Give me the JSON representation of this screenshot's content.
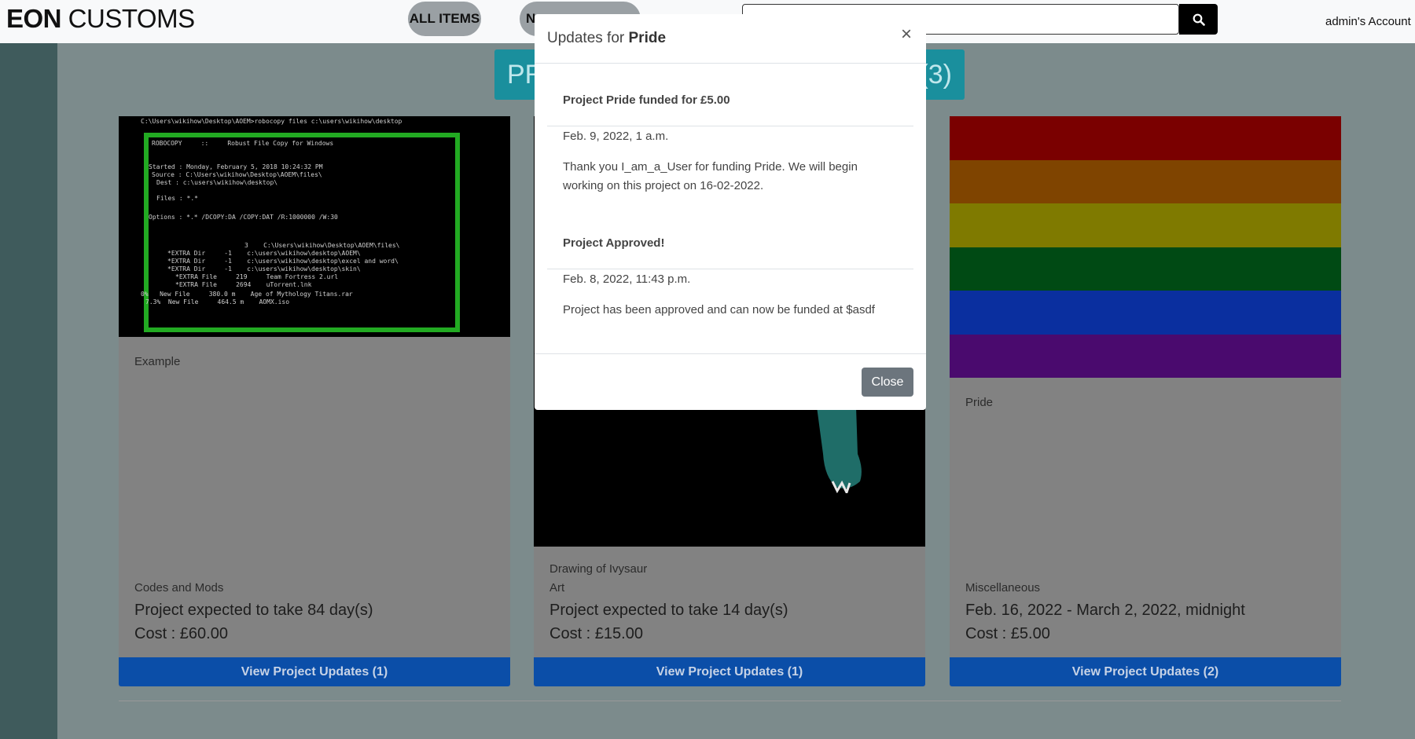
{
  "nav": {
    "brand_bold": "EON",
    "brand_rest": " CUSTOMS",
    "all_items": "ALL ITEMS",
    "new_partial": "N",
    "search": {
      "placeholder": "",
      "value": ""
    },
    "account": "admin's Account"
  },
  "heading": {
    "left": "PR",
    "right": "(3)"
  },
  "cards": [
    {
      "terminal_lines": [
        "C:\\Users\\wikihow\\Desktop\\AOEM>robocopy files c:\\users\\wikihow\\desktop",
        "ROBOCOPY     ::     Robust File Copy for Windows",
        "Started : Monday, February 5, 2018 10:24:32 PM",
        "Source : C:\\Users\\wikihow\\Desktop\\AOEM\\files\\",
        "Dest : c:\\users\\wikihow\\desktop\\",
        "Files : *.*",
        "Options : *.* /DCOPY:DA /COPY:DAT /R:1000000 /W:30",
        "3    C:\\Users\\wikihow\\Desktop\\AOEM\\files\\",
        "*EXTRA Dir     -1    c:\\users\\wikihow\\desktop\\AOEM\\",
        "*EXTRA Dir     -1    c:\\users\\wikihow\\desktop\\excel and word\\",
        "*EXTRA Dir     -1    c:\\users\\wikihow\\desktop\\skin\\",
        "*EXTRA File     219     Team Fortress 2.url",
        "*EXTRA File     2694    uTorrent.lnk",
        "0%   New File     380.0 m    Age of Mythology Titans.rar",
        "7.3%  New File     464.5 m    AOMX.iso"
      ],
      "name": "Example",
      "category": "Codes and Mods",
      "duration": "Project expected to take 84 day(s)",
      "cost": "Cost : £60.00",
      "button": "View Project Updates (1)"
    },
    {
      "name": "Drawing of Ivysaur",
      "category": "Art",
      "duration": "Project expected to take 14 day(s)",
      "cost": "Cost : £15.00",
      "button": "View Project Updates (1)"
    },
    {
      "name": "Pride",
      "category": "Miscellaneous",
      "duration": "Feb. 16, 2022 - March 2, 2022, midnight",
      "cost": "Cost : £5.00",
      "button": "View Project Updates (2)"
    }
  ],
  "modal": {
    "title_prefix": "Updates for ",
    "title_name": "Pride",
    "close_x": "×",
    "updates": [
      {
        "title": "Project Pride funded for £5.00",
        "date": "Feb. 9, 2022, 1 a.m.",
        "text": "Thank you I_am_a_User for funding Pride. We will begin working on this project on 16-02-2022."
      },
      {
        "title": "Project Approved!",
        "date": "Feb. 8, 2022, 11:43 p.m.",
        "text": "Project has been approved and can now be funded at $asdf"
      }
    ],
    "close_button": "Close"
  },
  "colors": {
    "primary_button": "#0b4ea8",
    "teal_badge": "#1a8f9d",
    "rainbow": [
      "#7a0000",
      "#7f4400",
      "#7f7a00",
      "#004a14",
      "#0a2f9f",
      "#4a0a6e"
    ]
  },
  "icons": {
    "search": "search-icon",
    "close": "close-icon"
  }
}
